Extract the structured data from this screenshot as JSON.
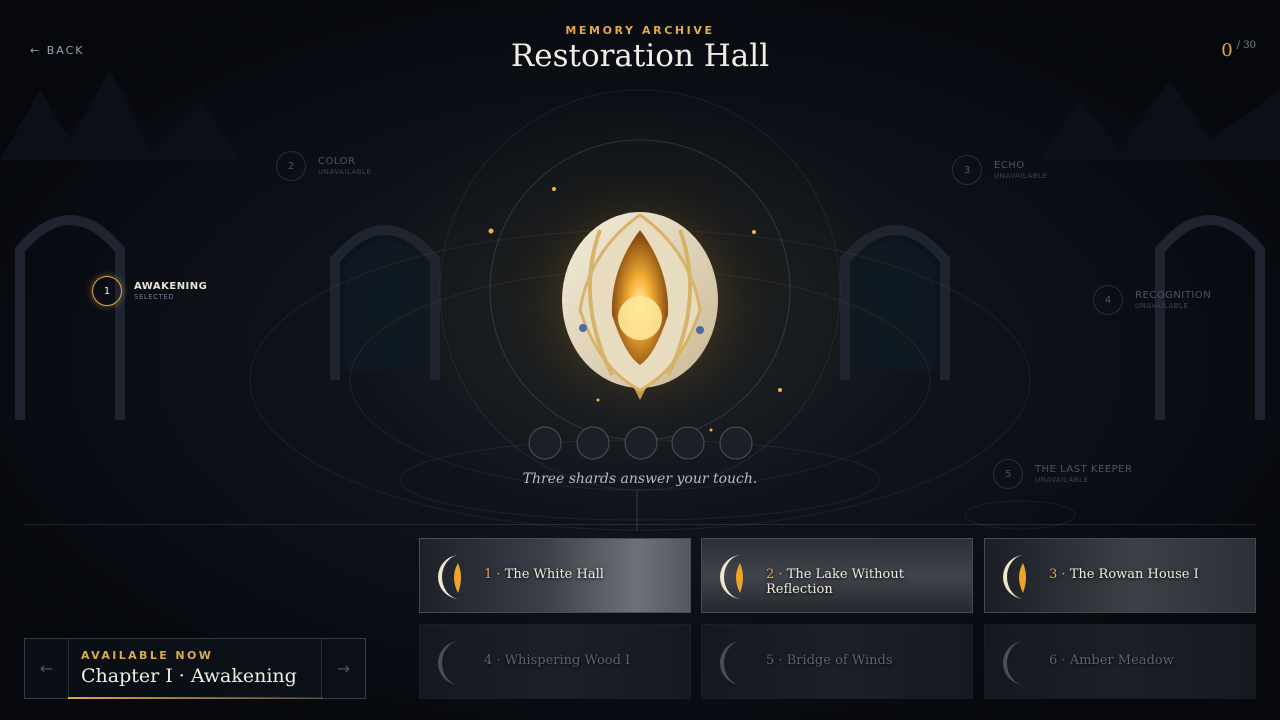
{
  "header": {
    "back_label": "← BACK",
    "eyebrow": "MEMORY ARCHIVE",
    "title": "Restoration Hall",
    "counter_current": "0",
    "counter_total": "/ 30"
  },
  "nodes": [
    {
      "num": "1",
      "name": "AWAKENING",
      "status": "SELECTED"
    },
    {
      "num": "2",
      "name": "COLOR",
      "status": "UNAVAILABLE"
    },
    {
      "num": "3",
      "name": "ECHO",
      "status": "UNAVAILABLE"
    },
    {
      "num": "4",
      "name": "RECOGNITION",
      "status": "UNAVAILABLE"
    },
    {
      "num": "5",
      "name": "THE LAST KEEPER",
      "status": "UNAVAILABLE"
    }
  ],
  "caption": "Three shards answer your touch.",
  "chapter": {
    "status": "AVAILABLE NOW",
    "name": "Chapter I · Awakening",
    "prev_icon": "←",
    "next_icon": "→"
  },
  "memories": [
    {
      "num": "1 ·",
      "name": "The White Hall",
      "locked": false
    },
    {
      "num": "2 ·",
      "name": "The Lake Without Reflection",
      "locked": false
    },
    {
      "num": "3 ·",
      "name": "The Rowan House I",
      "locked": false
    },
    {
      "num": "4 ·",
      "name": "Whispering Wood I",
      "locked": true
    },
    {
      "num": "5 ·",
      "name": "Bridge of Winds",
      "locked": true
    },
    {
      "num": "6 ·",
      "name": "Amber Meadow",
      "locked": true
    }
  ],
  "colors": {
    "accent": "#e0a94a",
    "background": "#0a0d14",
    "title": "#f2ede3"
  }
}
